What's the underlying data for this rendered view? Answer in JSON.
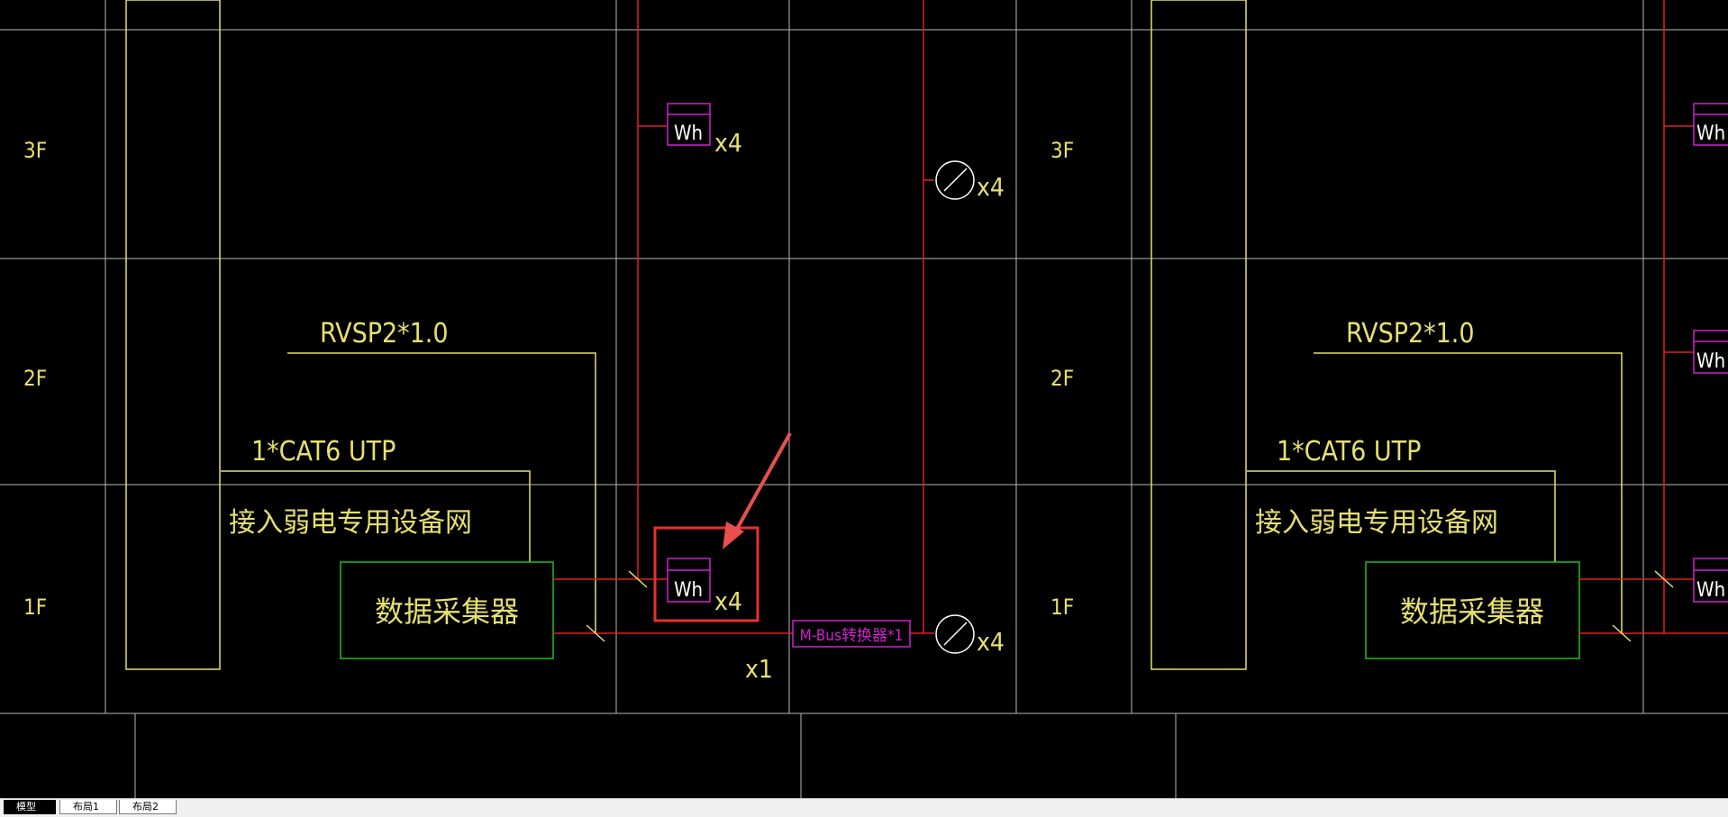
{
  "floors": [
    "3F",
    "2F",
    "1F"
  ],
  "left_panel": {
    "cable_rvsp": "RVSP2*1.0",
    "cable_cat6": "1*CAT6  UTP",
    "network_label": "接入弱电专用设备网",
    "collector_label": "数据采集器"
  },
  "right_panel": {
    "cable_rvsp": "RVSP2*1.0",
    "cable_cat6": "1*CAT6  UTP",
    "network_label": "接入弱电专用设备网",
    "collector_label": "数据采集器"
  },
  "meter_symbol": "Wh",
  "meter_count": "x4",
  "gauge_count": "x4",
  "converter_label": "M-Bus转换器*1",
  "converter_count": "x1",
  "tabs": [
    "模型",
    "布局1",
    "布局2"
  ],
  "colors": {
    "background": "#000000",
    "grid": "#c8c8c8",
    "cable_yellow": "#e6e070",
    "riser_red": "#e02020",
    "meter_magenta": "#d020d0",
    "collector_green": "#20c020",
    "highlight_red": "#e83030"
  }
}
